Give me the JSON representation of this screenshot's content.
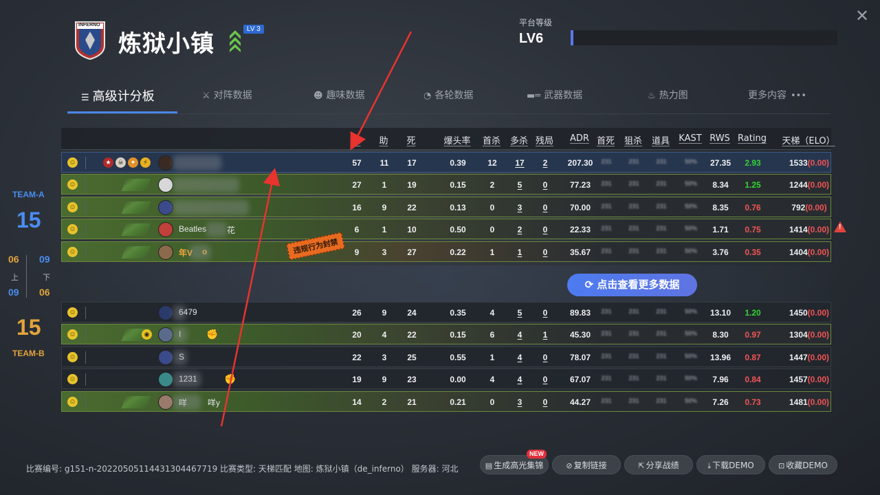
{
  "header": {
    "map_name": "炼狱小镇",
    "level_badge": "LV 3",
    "logo_text": "INFERNO",
    "platform_label": "平台等级",
    "platform_level": "LV6",
    "platform_progress": 0.01
  },
  "tabs": [
    {
      "label": "高级计分板",
      "icon": "list-icon",
      "active": true
    },
    {
      "label": "对阵数据",
      "icon": "versus-icon"
    },
    {
      "label": "趣味数据",
      "icon": "smile-icon"
    },
    {
      "label": "各轮数据",
      "icon": "clock-icon"
    },
    {
      "label": "武器数据",
      "icon": "rifle-icon"
    },
    {
      "label": "热力图",
      "icon": "flame-icon"
    },
    {
      "label": "更多内容",
      "icon": "dots-icon"
    }
  ],
  "columns": [
    "杀",
    "助",
    "死",
    "爆头率",
    "首杀",
    "多杀",
    "残局",
    "ADR",
    "首死",
    "狙杀",
    "道具",
    "KAST",
    "RWS",
    "Rating",
    "天梯（ELO）"
  ],
  "mask_values": {
    "first_death": "231",
    "sniper": "231",
    "utility": "231",
    "kast": "50%"
  },
  "team_a": {
    "label": "TEAM-A",
    "score": "15",
    "first_half": "06",
    "second_half": "09",
    "players": [
      {
        "name": "",
        "k": "57",
        "a": "11",
        "d": "17",
        "hs": "0.39",
        "fk": "12",
        "mk": "17",
        "clutch": "2",
        "adr": "207.30",
        "rws": "27.35",
        "rating": "2.93",
        "rating_color": "green",
        "elo": "1533",
        "elo_delta": "(0.00)"
      },
      {
        "name": "",
        "k": "27",
        "a": "1",
        "d": "19",
        "hs": "0.15",
        "fk": "2",
        "mk": "5",
        "clutch": "0",
        "adr": "77.23",
        "rws": "8.34",
        "rating": "1.25",
        "rating_color": "green",
        "elo": "1244",
        "elo_delta": "(0.00)"
      },
      {
        "name": "",
        "k": "16",
        "a": "9",
        "d": "22",
        "hs": "0.13",
        "fk": "0",
        "mk": "3",
        "clutch": "0",
        "adr": "70.00",
        "rws": "8.35",
        "rating": "0.76",
        "rating_color": "red",
        "elo": "792",
        "elo_delta": "(0.00)"
      },
      {
        "name": "Beatles",
        "name_suffix": "花",
        "k": "6",
        "a": "1",
        "d": "10",
        "hs": "0.50",
        "fk": "0",
        "mk": "2",
        "clutch": "0",
        "adr": "22.33",
        "rws": "1.71",
        "rating": "0.75",
        "rating_color": "red",
        "elo": "1414",
        "elo_delta": "(0.00)"
      },
      {
        "name": "年V",
        "name_suffix": "o",
        "k": "9",
        "a": "3",
        "d": "27",
        "hs": "0.22",
        "fk": "1",
        "mk": "1",
        "clutch": "0",
        "adr": "35.67",
        "rws": "3.76",
        "rating": "0.35",
        "rating_color": "red",
        "elo": "1404",
        "elo_delta": "(0.00)"
      }
    ]
  },
  "half_labels": {
    "first": "上",
    "second": "下"
  },
  "team_b": {
    "label": "TEAM-B",
    "score": "15",
    "first_half": "09",
    "second_half": "06",
    "players": [
      {
        "name": "6479",
        "k": "26",
        "a": "9",
        "d": "24",
        "hs": "0.35",
        "fk": "4",
        "mk": "5",
        "clutch": "0",
        "adr": "89.83",
        "rws": "13.10",
        "rating": "1.20",
        "rating_color": "green",
        "elo": "1450",
        "elo_delta": "(0.00)"
      },
      {
        "name": "I",
        "k": "20",
        "a": "4",
        "d": "22",
        "hs": "0.15",
        "fk": "6",
        "mk": "4",
        "clutch": "1",
        "adr": "45.30",
        "rws": "8.30",
        "rating": "0.97",
        "rating_color": "red",
        "elo": "1304",
        "elo_delta": "(0.00)"
      },
      {
        "name": "S",
        "k": "22",
        "a": "3",
        "d": "25",
        "hs": "0.55",
        "fk": "1",
        "mk": "4",
        "clutch": "0",
        "adr": "78.07",
        "rws": "13.96",
        "rating": "0.87",
        "rating_color": "red",
        "elo": "1447",
        "elo_delta": "(0.00)"
      },
      {
        "name": "1231",
        "k": "19",
        "a": "9",
        "d": "23",
        "hs": "0.00",
        "fk": "4",
        "mk": "4",
        "clutch": "0",
        "adr": "67.07",
        "rws": "7.96",
        "rating": "0.84",
        "rating_color": "red",
        "elo": "1457",
        "elo_delta": "(0.00)"
      },
      {
        "name": "咩",
        "name_suffix": "咩y",
        "k": "14",
        "a": "2",
        "d": "21",
        "hs": "0.21",
        "fk": "0",
        "mk": "3",
        "clutch": "0",
        "adr": "44.27",
        "rws": "7.26",
        "rating": "0.73",
        "rating_color": "red",
        "elo": "1481",
        "elo_delta": "(0.00)"
      }
    ]
  },
  "ban_stamp": "违规行为封禁",
  "more_data_button": "点击查看更多数据",
  "match_info": "比赛编号: g151-n-20220505114431304467719 比赛类型: 天梯匹配 地图: 炼狱小镇（de_inferno） 服务器: 河北",
  "footer_buttons": [
    {
      "label": "生成高光集锦",
      "icon": "film-icon"
    },
    {
      "label": "复制链接",
      "icon": "link-icon"
    },
    {
      "label": "分享战绩",
      "icon": "share-icon"
    },
    {
      "label": "下载DEMO",
      "icon": "download-icon"
    },
    {
      "label": "收藏DEMO",
      "icon": "bookmark-icon"
    }
  ],
  "new_badge": "NEW",
  "colors": {
    "accent_blue": "#4a86e8",
    "team_a": "#4a8df0",
    "team_b": "#e3a43a",
    "rating_green": "#35d435",
    "rating_red": "#f25555",
    "annotation_arrow": "#e8332f"
  }
}
